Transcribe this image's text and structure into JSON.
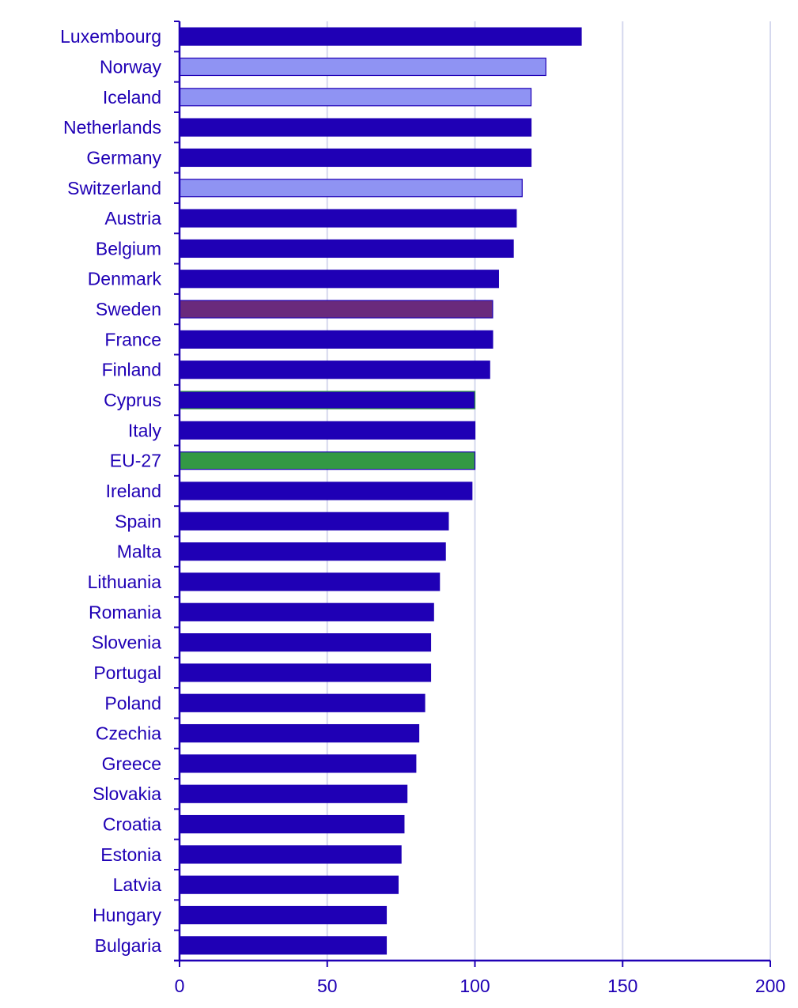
{
  "chart_data": {
    "type": "bar",
    "orientation": "horizontal",
    "title": "",
    "xlabel": "",
    "ylabel": "",
    "xlim": [
      0,
      200
    ],
    "xticks": [
      0,
      50,
      100,
      150,
      200
    ],
    "grid": "vertical",
    "legend": "none",
    "colors": {
      "default": "#1f00b5",
      "non_eu": "#8f93f3",
      "highlight": "#6a2a7c",
      "eu": "#339944",
      "axis": "#1f00b5",
      "grid": "#d5d8ee",
      "text": "#1f00b5"
    },
    "categories": [
      "Luxembourg",
      "Norway",
      "Iceland",
      "Netherlands",
      "Germany",
      "Switzerland",
      "Austria",
      "Belgium",
      "Denmark",
      "Sweden",
      "France",
      "Finland",
      "Cyprus",
      "Italy",
      "EU-27",
      "Ireland",
      "Spain",
      "Malta",
      "Lithuania",
      "Romania",
      "Slovenia",
      "Portugal",
      "Poland",
      "Czechia",
      "Greece",
      "Slovakia",
      "Croatia",
      "Estonia",
      "Latvia",
      "Hungary",
      "Bulgaria"
    ],
    "values": [
      136,
      124,
      119,
      119,
      119,
      116,
      114,
      113,
      108,
      106,
      106,
      105,
      100,
      100,
      100,
      99,
      91,
      90,
      88,
      86,
      85,
      85,
      83,
      81,
      80,
      77,
      76,
      75,
      74,
      70,
      70
    ],
    "bar_styles": [
      "default",
      "non_eu",
      "non_eu",
      "default",
      "default",
      "non_eu",
      "default",
      "default",
      "default",
      "highlight",
      "default",
      "default",
      "default-eu-outline",
      "default",
      "eu",
      "default",
      "default",
      "default",
      "default",
      "default",
      "default",
      "default",
      "default",
      "default",
      "default",
      "default",
      "default",
      "default",
      "default",
      "default",
      "default"
    ]
  }
}
